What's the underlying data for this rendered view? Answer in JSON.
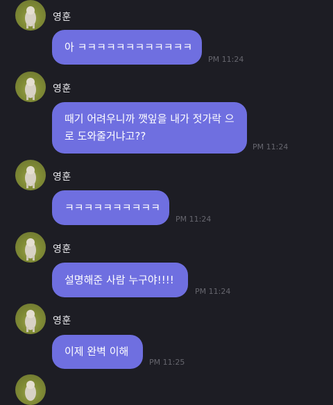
{
  "messages": [
    {
      "sender": "영훈",
      "text": "아 ㅋㅋㅋㅋㅋㅋㅋㅋㅋㅋㅋㅋ",
      "time": "PM 11:24"
    },
    {
      "sender": "영훈",
      "text": "때기 어려우니까 깻잎을 내가 젓가락 으로 도와줄거냐고??",
      "time": "PM 11:24"
    },
    {
      "sender": "영훈",
      "text": "ㅋㅋㅋㅋㅋㅋㅋㅋㅋㅋ",
      "time": "PM 11:24"
    },
    {
      "sender": "영훈",
      "text": "설명해준 사람 누구야!!!!",
      "time": "PM 11:24"
    },
    {
      "sender": "영훈",
      "text": "이제 완벽 이해",
      "time": "PM 11:25"
    }
  ],
  "colors": {
    "background": "#1d1d24",
    "bubble": "#6f6fe0",
    "bubble_text": "#ffffff",
    "sender_text": "#e6e6ea",
    "time_text": "#66666e"
  },
  "icons": {
    "avatar": "profile-photo-dog-icon"
  }
}
